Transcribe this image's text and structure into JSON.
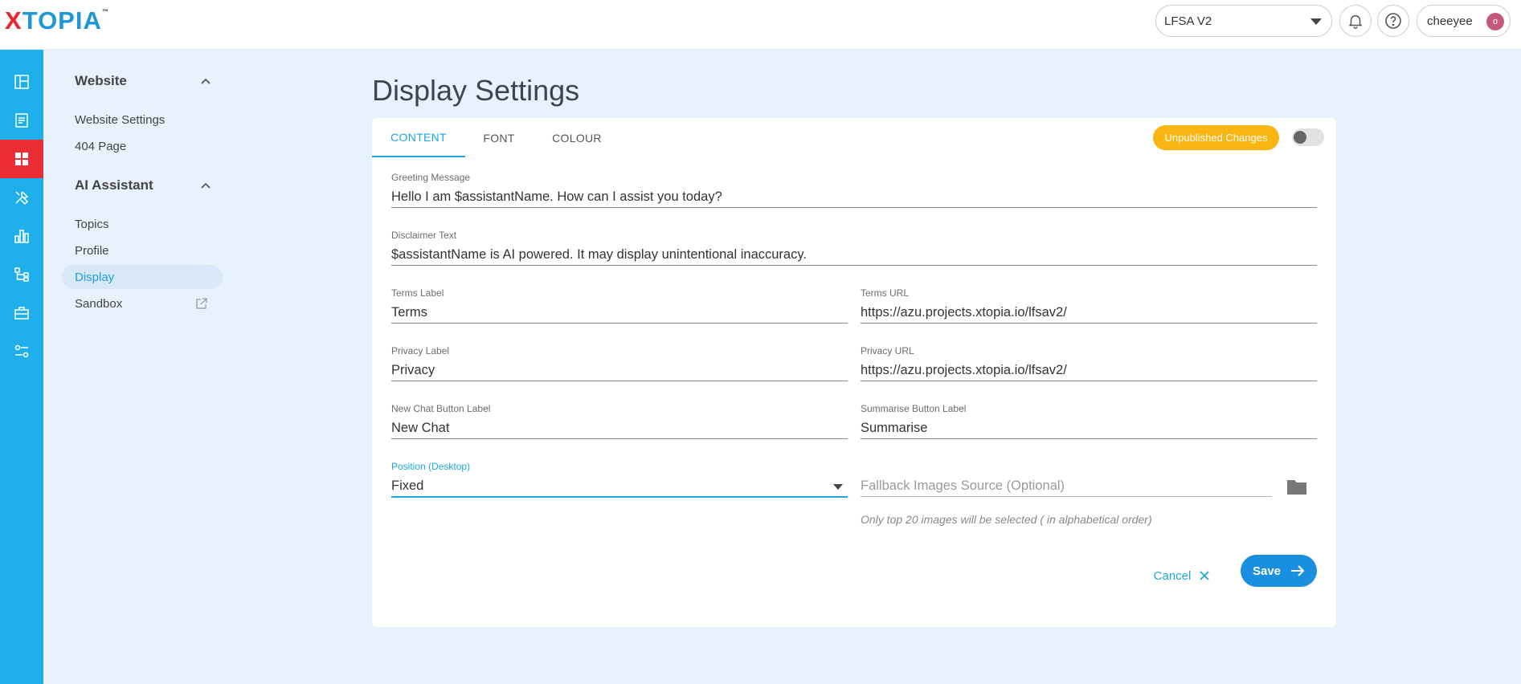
{
  "brand": {
    "logo_x": "X",
    "logo_rest": "TOPIA",
    "trademark": "™"
  },
  "header": {
    "project": "LFSA V2",
    "username": "cheeyee",
    "avatar_initial": "o"
  },
  "rail": {
    "items": [
      {
        "icon": "layout-icon",
        "active": false
      },
      {
        "icon": "document-icon",
        "active": false
      },
      {
        "icon": "grid-icon",
        "active": true
      },
      {
        "icon": "tools-icon",
        "active": false
      },
      {
        "icon": "bar-chart-icon",
        "active": false
      },
      {
        "icon": "sitemap-icon",
        "active": false
      },
      {
        "icon": "briefcase-icon",
        "active": false
      },
      {
        "icon": "settings-sliders-icon",
        "active": false
      }
    ]
  },
  "sidebar": {
    "section1": {
      "title": "Website",
      "items": [
        "Website Settings",
        "404 Page"
      ]
    },
    "section2": {
      "title": "AI Assistant",
      "items": [
        "Topics",
        "Profile",
        "Display",
        "Sandbox"
      ],
      "active": "Display"
    }
  },
  "page": {
    "title": "Display Settings"
  },
  "tabs": [
    "CONTENT",
    "FONT",
    "COLOUR"
  ],
  "active_tab": "CONTENT",
  "status_badge": "Unpublished Changes",
  "form": {
    "greeting": {
      "label": "Greeting Message",
      "value": "Hello I am $assistantName. How can I assist you today?"
    },
    "disclaimer": {
      "label": "Disclaimer Text",
      "value": "$assistantName is AI powered. It may display unintentional inaccuracy."
    },
    "terms_label": {
      "label": "Terms Label",
      "value": "Terms"
    },
    "terms_url": {
      "label": "Terms URL",
      "value": "https://azu.projects.xtopia.io/lfsav2/"
    },
    "privacy_label": {
      "label": "Privacy Label",
      "value": "Privacy"
    },
    "privacy_url": {
      "label": "Privacy URL",
      "value": "https://azu.projects.xtopia.io/lfsav2/"
    },
    "new_chat": {
      "label": "New Chat Button Label",
      "value": "New Chat"
    },
    "summarise": {
      "label": "Summarise Button Label",
      "value": "Summarise"
    },
    "position": {
      "label": "Position (Desktop)",
      "value": "Fixed"
    },
    "fallback": {
      "placeholder": "Fallback Images Source (Optional)"
    },
    "hint": "Only top 20 images will be selected ( in alphabetical order)"
  },
  "actions": {
    "cancel": "Cancel",
    "save": "Save"
  },
  "colors": {
    "accent": "#1fa7dc",
    "rail": "#1fb0ec",
    "active_rail": "#ec2d35",
    "badge": "#fbb512",
    "save": "#1a8fdf"
  }
}
